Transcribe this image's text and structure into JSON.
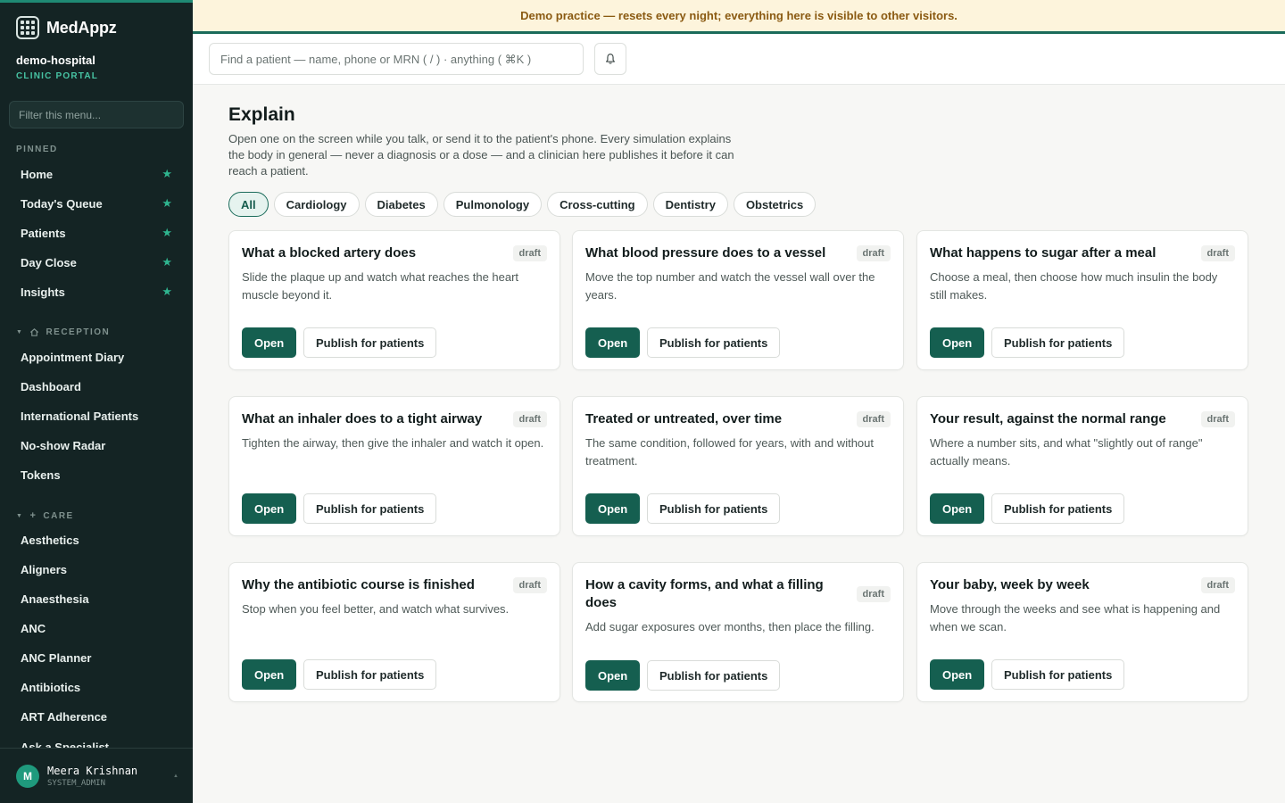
{
  "banner": {
    "text": "Demo practice — resets every night; everything here is visible to other visitors."
  },
  "brand": {
    "name": "MedAppz",
    "logo_icon": "grid-logo-icon"
  },
  "org": {
    "name": "demo-hospital",
    "subtitle": "CLINIC PORTAL"
  },
  "menu_filter": {
    "placeholder": "Filter this menu..."
  },
  "sidebar": {
    "pinned": {
      "label": "PINNED",
      "items": [
        {
          "label": "Home",
          "icon": "star-icon"
        },
        {
          "label": "Today's Queue",
          "icon": "star-icon"
        },
        {
          "label": "Patients",
          "icon": "star-icon"
        },
        {
          "label": "Day Close",
          "icon": "star-icon"
        },
        {
          "label": "Insights",
          "icon": "star-icon"
        }
      ]
    },
    "reception": {
      "label": "RECEPTION",
      "icon": "home-icon",
      "items": [
        {
          "label": "Appointment Diary"
        },
        {
          "label": "Dashboard"
        },
        {
          "label": "International Patients"
        },
        {
          "label": "No-show Radar"
        },
        {
          "label": "Tokens"
        }
      ]
    },
    "care": {
      "label": "CARE",
      "icon": "plus-icon",
      "items": [
        {
          "label": "Aesthetics"
        },
        {
          "label": "Aligners"
        },
        {
          "label": "Anaesthesia"
        },
        {
          "label": "ANC"
        },
        {
          "label": "ANC Planner"
        },
        {
          "label": "Antibiotics"
        },
        {
          "label": "ART Adherence"
        },
        {
          "label": "Ask a Specialist"
        }
      ]
    }
  },
  "user": {
    "initial": "M",
    "name": "Meera Krishnan",
    "role": "SYSTEM_ADMIN"
  },
  "search": {
    "placeholder": "Find a patient — name, phone or MRN ( / ) · anything ( ⌘K )"
  },
  "page": {
    "title": "Explain",
    "description": "Open one on the screen while you talk, or send it to the patient's phone. Every simulation explains the body in general — never a diagnosis or a dose — and a clinician here publishes it before it can reach a patient."
  },
  "filters": [
    {
      "label": "All",
      "active": true
    },
    {
      "label": "Cardiology",
      "active": false
    },
    {
      "label": "Diabetes",
      "active": false
    },
    {
      "label": "Pulmonology",
      "active": false
    },
    {
      "label": "Cross-cutting",
      "active": false
    },
    {
      "label": "Dentistry",
      "active": false
    },
    {
      "label": "Obstetrics",
      "active": false
    }
  ],
  "cards": [
    {
      "title": "What a blocked artery does",
      "badge": "draft",
      "desc": "Slide the plaque up and watch what reaches the heart muscle beyond it.",
      "open": "Open",
      "publish": "Publish for patients"
    },
    {
      "title": "What blood pressure does to a vessel",
      "badge": "draft",
      "desc": "Move the top number and watch the vessel wall over the years.",
      "open": "Open",
      "publish": "Publish for patients"
    },
    {
      "title": "What happens to sugar after a meal",
      "badge": "draft",
      "desc": "Choose a meal, then choose how much insulin the body still makes.",
      "open": "Open",
      "publish": "Publish for patients"
    },
    {
      "title": "What an inhaler does to a tight airway",
      "badge": "draft",
      "desc": "Tighten the airway, then give the inhaler and watch it open.",
      "open": "Open",
      "publish": "Publish for patients"
    },
    {
      "title": "Treated or untreated, over time",
      "badge": "draft",
      "desc": "The same condition, followed for years, with and without treatment.",
      "open": "Open",
      "publish": "Publish for patients"
    },
    {
      "title": "Your result, against the normal range",
      "badge": "draft",
      "desc": "Where a number sits, and what \"slightly out of range\" actually means.",
      "open": "Open",
      "publish": "Publish for patients"
    },
    {
      "title": "Why the antibiotic course is finished",
      "badge": "draft",
      "desc": "Stop when you feel better, and watch what survives.",
      "open": "Open",
      "publish": "Publish for patients"
    },
    {
      "title": "How a cavity forms, and what a filling does",
      "badge": "draft",
      "desc": "Add sugar exposures over months, then place the filling.",
      "open": "Open",
      "publish": "Publish for patients"
    },
    {
      "title": "Your baby, week by week",
      "badge": "draft",
      "desc": "Move through the weeks and see what is happening and when we scan.",
      "open": "Open",
      "publish": "Publish for patients"
    }
  ],
  "colors": {
    "accent": "#155f50",
    "sidebar_bg": "#142424",
    "star": "#2fb58f",
    "banner_bg": "#fdf4dc",
    "banner_text": "#8a5a12"
  }
}
